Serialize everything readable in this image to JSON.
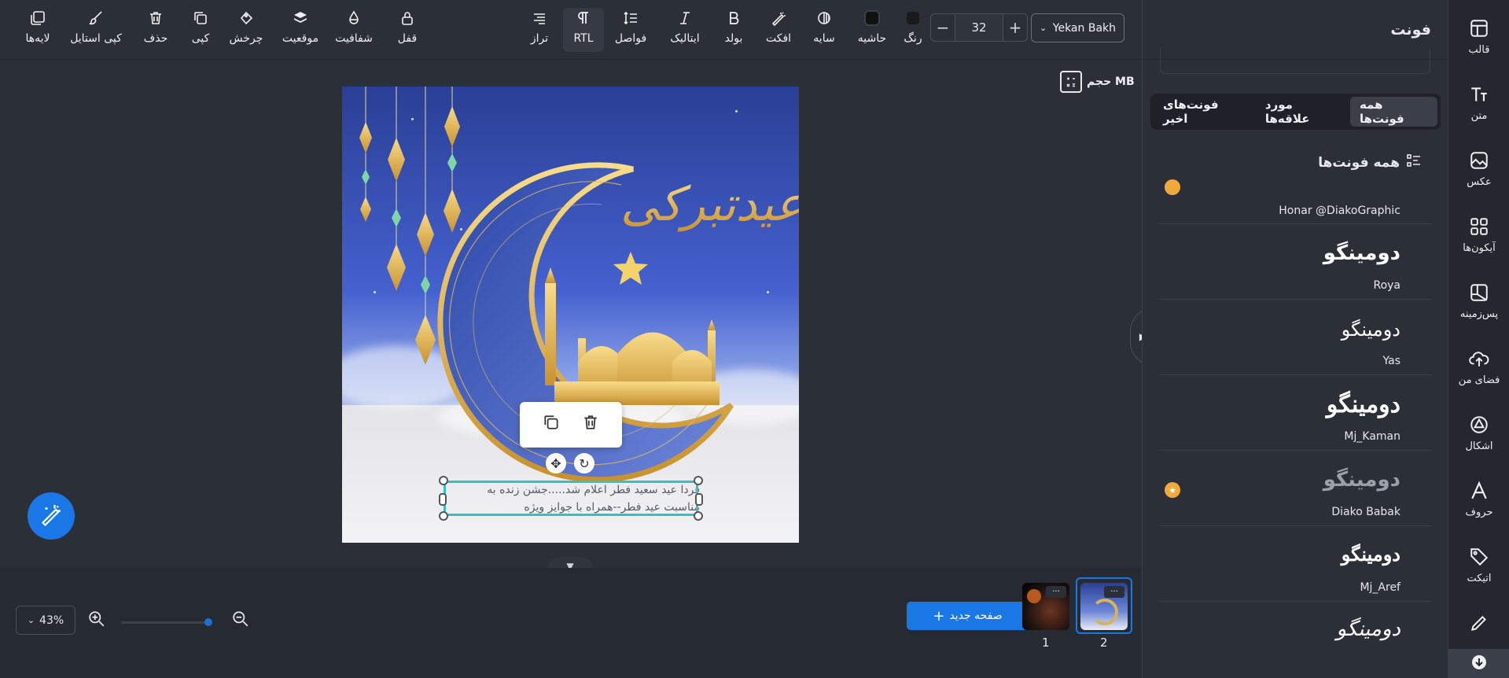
{
  "toolbar": {
    "layers": "لایه‌ها",
    "copy_style": "کپی استایل",
    "delete": "حذف",
    "copy": "کپی",
    "rotate": "چرخش",
    "position": "موقعیت",
    "opacity": "شفافیت",
    "lock": "قفل",
    "align": "تراز",
    "rtl": "RTL",
    "spacing": "فواصل",
    "italic": "ایتالیک",
    "bold": "بولد",
    "effect": "افکت",
    "shadow": "سایه",
    "border": "حاشیه",
    "color": "رنگ",
    "font_size": "32",
    "font_family": "Yekan Bakh"
  },
  "canvas": {
    "size_label": "حجم MB",
    "text_line1": "فردا عید سعید فطر اعلام شد.....جشن زنده به",
    "text_line2": "مناسبت عید فطر--همراه با جوایز ویژه",
    "calligraphy": "عیدتبرکی"
  },
  "bottom": {
    "zoom": "43%",
    "new_page": "صفحه جدید",
    "pages": [
      {
        "num": "1",
        "dots": "···"
      },
      {
        "num": "2",
        "dots": "···"
      }
    ]
  },
  "panel": {
    "title": "فونت",
    "tabs": [
      "همه فونت‌ها",
      "مورد علاقه‌ها",
      "فونت‌های اخیر"
    ],
    "section_title": "همه فونت‌ها",
    "fonts": [
      {
        "sample": "",
        "name": "Honar @DiakoGraphic"
      },
      {
        "sample": "دومینگو",
        "name": "Roya"
      },
      {
        "sample": "دومینگو",
        "name": "Yas"
      },
      {
        "sample": "دومینگو",
        "name": "Mj_Kaman"
      },
      {
        "sample": "دومینگو",
        "name": "Diako Babak"
      },
      {
        "sample": "دومینگو",
        "name": "Mj_Aref"
      },
      {
        "sample": "دومینگو",
        "name": ""
      }
    ]
  },
  "sidenav": [
    {
      "label": "قالب",
      "icon": "template-icon"
    },
    {
      "label": "متن",
      "icon": "text-icon"
    },
    {
      "label": "عکس",
      "icon": "photo-icon"
    },
    {
      "label": "آیکون‌ها",
      "icon": "icons-icon"
    },
    {
      "label": "پس‌زمینه",
      "icon": "background-icon"
    },
    {
      "label": "فضای من",
      "icon": "cloud-upload-icon"
    },
    {
      "label": "اشکال",
      "icon": "shapes-icon"
    },
    {
      "label": "حروف",
      "icon": "letters-icon"
    },
    {
      "label": "اتیکت",
      "icon": "tag-icon"
    },
    {
      "label": "",
      "icon": "pen-icon"
    }
  ],
  "colors": {
    "accent": "#1a78e6",
    "selection": "#2ec4c4",
    "premium": "#f2a93b",
    "bg": "#2b2f38"
  }
}
